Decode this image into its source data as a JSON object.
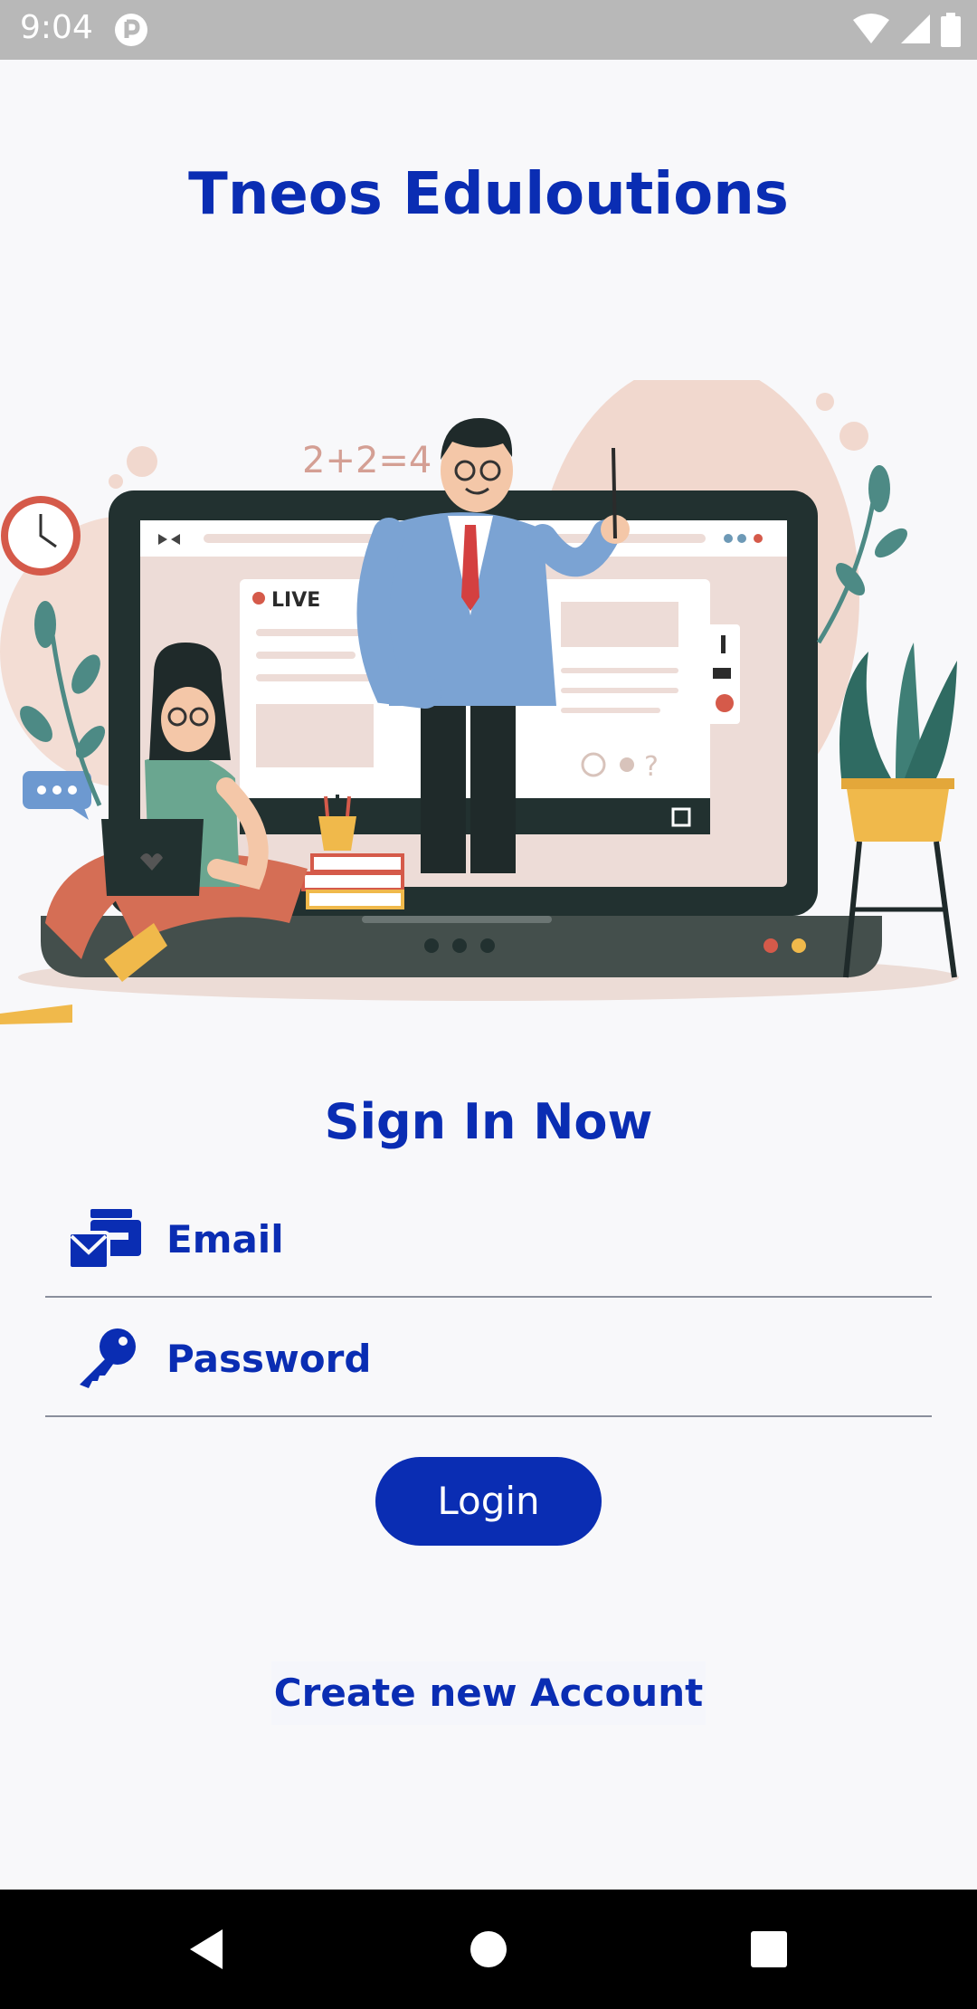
{
  "status_bar": {
    "time": "9:04",
    "icons": [
      "app-notification-icon",
      "wifi-icon",
      "signal-icon",
      "battery-icon"
    ]
  },
  "app": {
    "title": "Tneos Eduloutions"
  },
  "hero": {
    "board_text": "2+2=4",
    "live_badge": "LIVE"
  },
  "signin": {
    "title": "Sign In Now",
    "email_placeholder": "Email",
    "password_placeholder": "Password",
    "login_label": "Login",
    "create_account_label": "Create new Account"
  },
  "colors": {
    "brand": "#0a2db3",
    "background": "#f8f8fa",
    "status_bar": "#b8b8b8",
    "nav_bar": "#000000"
  },
  "nav_bar": {
    "icons": [
      "back-icon",
      "home-icon",
      "recents-icon"
    ]
  }
}
